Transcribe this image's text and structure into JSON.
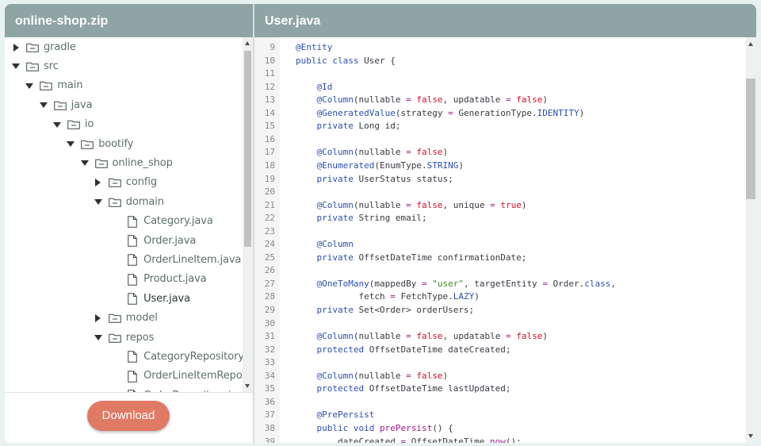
{
  "left_panel": {
    "title": "online-shop.zip"
  },
  "right_panel": {
    "title": "User.java"
  },
  "tree": [
    {
      "label": "gradle",
      "type": "folder",
      "expanded": false,
      "depth": 0
    },
    {
      "label": "src",
      "type": "folder",
      "expanded": true,
      "depth": 0
    },
    {
      "label": "main",
      "type": "folder",
      "expanded": true,
      "depth": 1
    },
    {
      "label": "java",
      "type": "folder",
      "expanded": true,
      "depth": 2
    },
    {
      "label": "io",
      "type": "folder",
      "expanded": true,
      "depth": 3
    },
    {
      "label": "bootify",
      "type": "folder",
      "expanded": true,
      "depth": 4
    },
    {
      "label": "online_shop",
      "type": "folder",
      "expanded": true,
      "depth": 5
    },
    {
      "label": "config",
      "type": "folder",
      "expanded": false,
      "depth": 6
    },
    {
      "label": "domain",
      "type": "folder",
      "expanded": true,
      "depth": 6
    },
    {
      "label": "Category.java",
      "type": "file",
      "depth": 7
    },
    {
      "label": "Order.java",
      "type": "file",
      "depth": 7
    },
    {
      "label": "OrderLineItem.java",
      "type": "file",
      "depth": 7
    },
    {
      "label": "Product.java",
      "type": "file",
      "depth": 7
    },
    {
      "label": "User.java",
      "type": "file",
      "depth": 7,
      "active": true
    },
    {
      "label": "model",
      "type": "folder",
      "expanded": false,
      "depth": 6
    },
    {
      "label": "repos",
      "type": "folder",
      "expanded": true,
      "depth": 6
    },
    {
      "label": "CategoryRepository.java",
      "type": "file",
      "depth": 7
    },
    {
      "label": "OrderLineItemRepository.java",
      "type": "file",
      "depth": 7
    },
    {
      "label": "OrderRepository.java",
      "type": "file",
      "depth": 7
    }
  ],
  "download_button": {
    "label": "Download"
  },
  "code_lines": [
    {
      "n": "9",
      "t": [
        [
          "a",
          "@Entity"
        ]
      ]
    },
    {
      "n": "10",
      "t": [
        [
          "kw2",
          "public "
        ],
        [
          "kw2",
          "class "
        ],
        [
          "p",
          "User {"
        ]
      ]
    },
    {
      "n": "11",
      "t": []
    },
    {
      "n": "12",
      "t": [
        [
          "p",
          "    "
        ],
        [
          "a",
          "@Id"
        ]
      ]
    },
    {
      "n": "13",
      "t": [
        [
          "p",
          "    "
        ],
        [
          "a",
          "@Column"
        ],
        [
          "p",
          "(nullable "
        ],
        [
          "kw",
          "="
        ],
        [
          "p",
          " "
        ],
        [
          "val",
          "false"
        ],
        [
          "p",
          ", updatable "
        ],
        [
          "kw",
          "="
        ],
        [
          "p",
          " "
        ],
        [
          "val",
          "false"
        ],
        [
          "p",
          ")"
        ]
      ]
    },
    {
      "n": "14",
      "t": [
        [
          "p",
          "    "
        ],
        [
          "a",
          "@GeneratedValue"
        ],
        [
          "p",
          "(strategy "
        ],
        [
          "kw",
          "="
        ],
        [
          "p",
          " GenerationType."
        ],
        [
          "kw2",
          "IDENTITY"
        ],
        [
          "p",
          ")"
        ]
      ]
    },
    {
      "n": "15",
      "t": [
        [
          "p",
          "    "
        ],
        [
          "kw2",
          "private "
        ],
        [
          "p",
          "Long id;"
        ]
      ]
    },
    {
      "n": "16",
      "t": []
    },
    {
      "n": "17",
      "t": [
        [
          "p",
          "    "
        ],
        [
          "a",
          "@Column"
        ],
        [
          "p",
          "(nullable "
        ],
        [
          "kw",
          "="
        ],
        [
          "p",
          " "
        ],
        [
          "val",
          "false"
        ],
        [
          "p",
          ")"
        ]
      ]
    },
    {
      "n": "18",
      "t": [
        [
          "p",
          "    "
        ],
        [
          "a",
          "@Enumerated"
        ],
        [
          "p",
          "(EnumType."
        ],
        [
          "kw2",
          "STRING"
        ],
        [
          "p",
          ")"
        ]
      ]
    },
    {
      "n": "19",
      "t": [
        [
          "p",
          "    "
        ],
        [
          "kw2",
          "private "
        ],
        [
          "p",
          "UserStatus status;"
        ]
      ]
    },
    {
      "n": "20",
      "t": []
    },
    {
      "n": "21",
      "t": [
        [
          "p",
          "    "
        ],
        [
          "a",
          "@Column"
        ],
        [
          "p",
          "(nullable "
        ],
        [
          "kw",
          "="
        ],
        [
          "p",
          " "
        ],
        [
          "val",
          "false"
        ],
        [
          "p",
          ", unique "
        ],
        [
          "kw",
          "="
        ],
        [
          "p",
          " "
        ],
        [
          "val",
          "true"
        ],
        [
          "p",
          ")"
        ]
      ]
    },
    {
      "n": "22",
      "t": [
        [
          "p",
          "    "
        ],
        [
          "kw2",
          "private "
        ],
        [
          "p",
          "String email;"
        ]
      ]
    },
    {
      "n": "23",
      "t": []
    },
    {
      "n": "24",
      "t": [
        [
          "p",
          "    "
        ],
        [
          "a",
          "@Column"
        ]
      ]
    },
    {
      "n": "25",
      "t": [
        [
          "p",
          "    "
        ],
        [
          "kw2",
          "private "
        ],
        [
          "p",
          "OffsetDateTime confirmationDate;"
        ]
      ]
    },
    {
      "n": "26",
      "t": []
    },
    {
      "n": "27",
      "t": [
        [
          "p",
          "    "
        ],
        [
          "a",
          "@OneToMany"
        ],
        [
          "p",
          "(mappedBy "
        ],
        [
          "kw",
          "="
        ],
        [
          "p",
          " "
        ],
        [
          "str",
          "\"user\""
        ],
        [
          "p",
          ", targetEntity "
        ],
        [
          "kw",
          "="
        ],
        [
          "p",
          " Order."
        ],
        [
          "kw2",
          "class"
        ],
        [
          "p",
          ","
        ]
      ]
    },
    {
      "n": "28",
      "t": [
        [
          "p",
          "            fetch "
        ],
        [
          "kw",
          "="
        ],
        [
          "p",
          " FetchType."
        ],
        [
          "kw2",
          "LAZY"
        ],
        [
          "p",
          ")"
        ]
      ]
    },
    {
      "n": "29",
      "t": [
        [
          "p",
          "    "
        ],
        [
          "kw2",
          "private "
        ],
        [
          "p",
          "Set<Order> orderUsers;"
        ]
      ]
    },
    {
      "n": "30",
      "t": []
    },
    {
      "n": "31",
      "t": [
        [
          "p",
          "    "
        ],
        [
          "a",
          "@Column"
        ],
        [
          "p",
          "(nullable "
        ],
        [
          "kw",
          "="
        ],
        [
          "p",
          " "
        ],
        [
          "val",
          "false"
        ],
        [
          "p",
          ", updatable "
        ],
        [
          "kw",
          "="
        ],
        [
          "p",
          " "
        ],
        [
          "val",
          "false"
        ],
        [
          "p",
          ")"
        ]
      ]
    },
    {
      "n": "32",
      "t": [
        [
          "p",
          "    "
        ],
        [
          "kw2",
          "protected "
        ],
        [
          "p",
          "OffsetDateTime dateCreated;"
        ]
      ]
    },
    {
      "n": "33",
      "t": []
    },
    {
      "n": "34",
      "t": [
        [
          "p",
          "    "
        ],
        [
          "a",
          "@Column"
        ],
        [
          "p",
          "(nullable "
        ],
        [
          "kw",
          "="
        ],
        [
          "p",
          " "
        ],
        [
          "val",
          "false"
        ],
        [
          "p",
          ")"
        ]
      ]
    },
    {
      "n": "35",
      "t": [
        [
          "p",
          "    "
        ],
        [
          "kw2",
          "protected "
        ],
        [
          "p",
          "OffsetDateTime lastUpdated;"
        ]
      ]
    },
    {
      "n": "36",
      "t": []
    },
    {
      "n": "37",
      "t": [
        [
          "p",
          "    "
        ],
        [
          "a",
          "@PrePersist"
        ]
      ]
    },
    {
      "n": "38",
      "t": [
        [
          "p",
          "    "
        ],
        [
          "kw2",
          "public "
        ],
        [
          "kw2",
          "void "
        ],
        [
          "kw",
          "prePersist"
        ],
        [
          "p",
          "() {"
        ]
      ]
    },
    {
      "n": "39",
      "t": [
        [
          "p",
          "        dateCreated "
        ],
        [
          "kw",
          "="
        ],
        [
          "p",
          " OffsetDateTime."
        ],
        [
          "kw",
          "now"
        ],
        [
          "p",
          "();"
        ]
      ]
    }
  ],
  "colors": {
    "header": "#8ea5a3",
    "button": "#e07a65",
    "background": "#e8f3f1"
  },
  "icons": {
    "folder": "folder-icon",
    "file": "file-icon",
    "expand": "caret-icon"
  }
}
